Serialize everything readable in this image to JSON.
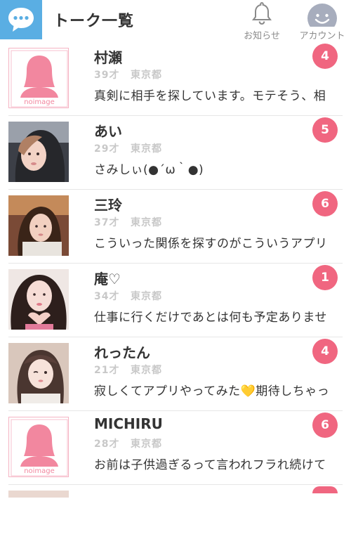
{
  "header": {
    "title": "トーク一覧",
    "notice_label": "お知らせ",
    "account_label": "アカウント"
  },
  "colors": {
    "brand": "#5aaee3",
    "badge": "#f06680",
    "noimage_pink": "#f2879f"
  },
  "noimage_text": "noimage",
  "talks": [
    {
      "name": "村瀬",
      "age": "39才",
      "area": "東京都",
      "message": "真剣に相手を探しています。モテそう、相",
      "unread": "4",
      "avatar": "noimage"
    },
    {
      "name": "あい",
      "age": "29才",
      "area": "東京都",
      "message": "さみしぃ(●´ω｀●)",
      "unread": "5",
      "avatar": "photo"
    },
    {
      "name": "三玲",
      "age": "37才",
      "area": "東京都",
      "message": "こういった関係を探すのがこういうアプリ",
      "unread": "6",
      "avatar": "photo"
    },
    {
      "name": "庵♡",
      "age": "34才",
      "area": "東京都",
      "message": "仕事に行くだけであとは何も予定ありませ",
      "unread": "1",
      "avatar": "photo"
    },
    {
      "name": "れったん",
      "age": "21才",
      "area": "東京都",
      "message": "寂しくてアプリやってみた💛期待しちゃっ",
      "unread": "4",
      "avatar": "photo"
    },
    {
      "name": "MICHIRU",
      "age": "28才",
      "area": "東京都",
      "message": "お前は子供過ぎるって言われフラれ続けて",
      "unread": "6",
      "avatar": "noimage"
    }
  ]
}
